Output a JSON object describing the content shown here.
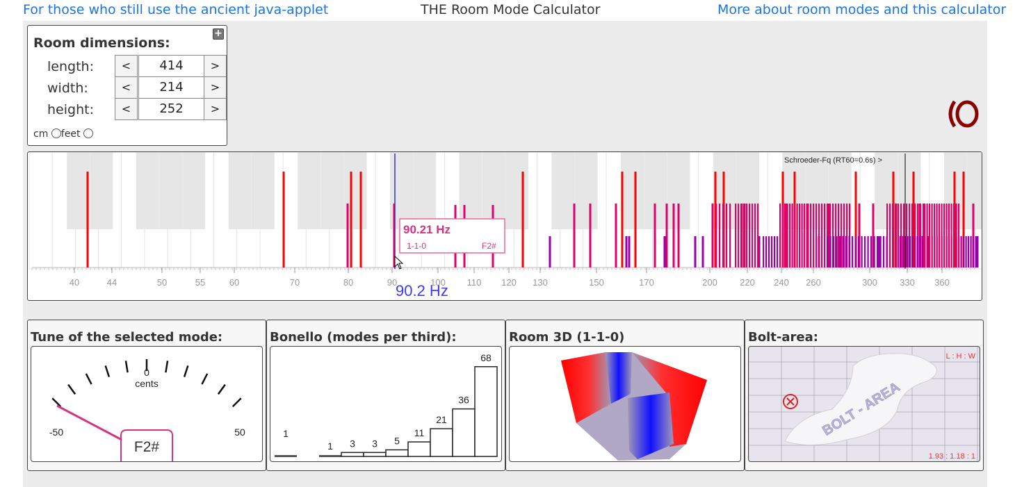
{
  "header": {
    "left_link": "For those who still use the ancient java-applet",
    "title": "THE Room Mode Calculator",
    "right_link": "More about room modes and this calculator"
  },
  "dimensions": {
    "title": "Room dimensions:",
    "expand_label": "+",
    "rows": [
      {
        "label": "length:",
        "value": "414",
        "dec": "<",
        "inc": ">"
      },
      {
        "label": "width:",
        "value": "214",
        "dec": "<",
        "inc": ">"
      },
      {
        "label": "height:",
        "value": "252",
        "dec": "<",
        "inc": ">"
      }
    ],
    "unit_cm": "cm",
    "unit_feet": "feet"
  },
  "spectrum": {
    "schroeder_label": "Schroeder-Fq (RT60=0.6s) >",
    "tooltip_freq": "90.21 Hz",
    "tooltip_mode": "1-1-0",
    "tooltip_note": "F2#",
    "selected_readout": "90.2 Hz",
    "ticks": [
      "40",
      "44",
      "50",
      "55",
      "60",
      "70",
      "80",
      "90",
      "100",
      "110",
      "120",
      "130",
      "150",
      "170",
      "200",
      "220",
      "240",
      "260",
      "300",
      "330",
      "360"
    ]
  },
  "tune_panel": {
    "title": "Tune of the selected mode:",
    "zero": "0",
    "cents": "cents",
    "min": "-50",
    "max": "50",
    "note": "F2#"
  },
  "bonello_panel": {
    "title": "Bonello (modes per third):",
    "counts": [
      "1",
      "",
      "1",
      "3",
      "3",
      "5",
      "11",
      "21",
      "36",
      "68"
    ]
  },
  "room3d_panel": {
    "title": "Room 3D (1-1-0)"
  },
  "bolt_panel": {
    "title": "Bolt-area:",
    "ratio_label": "L : H : W",
    "ratio_value": "1.93 : 1.18 : 1",
    "watermark": "BOLT - AREA"
  },
  "colors": {
    "link": "#1a73e8",
    "axial": "#ff0000",
    "tangential": "#e0006a",
    "oblique": "#9900aa",
    "selected_line": "#3333cc"
  }
}
